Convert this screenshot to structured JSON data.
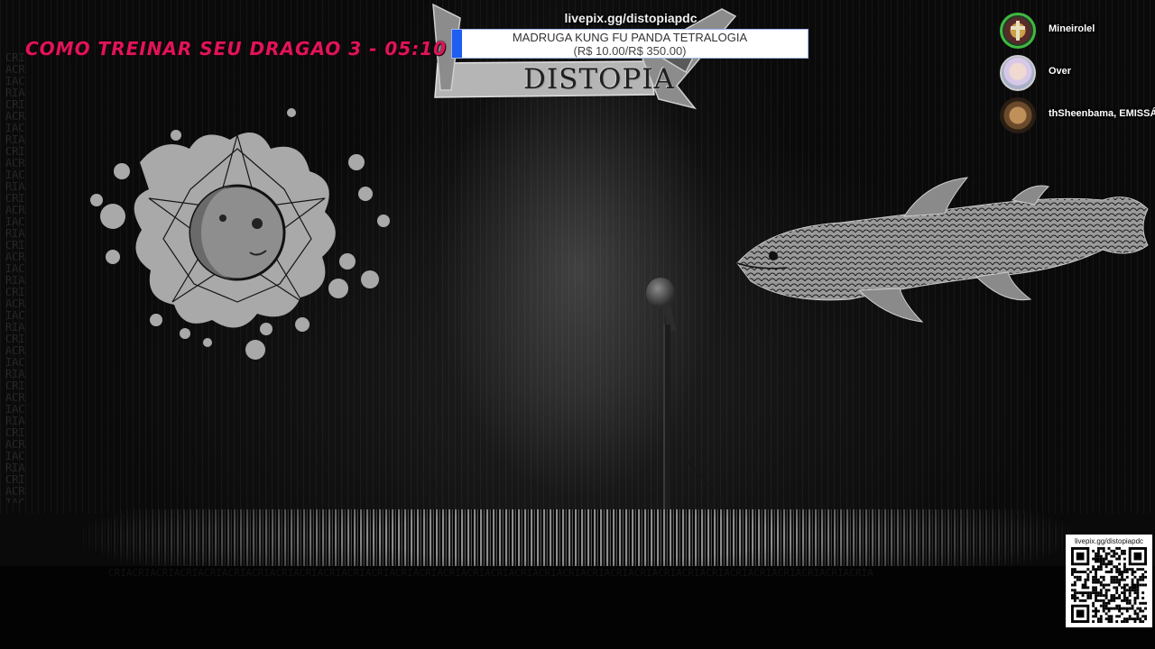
{
  "stream": {
    "title": "COMO TREINAR SEU DRAGAO 3 - 05:10",
    "logo_text": "DISTOPIA",
    "background_repeat_text": "CRIACRIACRIACRIACRIACRIACRIACRIACRIACRIACRIACRIACRIACRIACRIACRIACRIACRIACRIACRIACRIACRIACRIACRIACRIACRIACRIACRIACRIACRIACRIACRIA"
  },
  "donation_goal": {
    "url": "livepix.gg/distopiapdc",
    "name": "MADRUGA KUNG FU PANDA TETRALOGIA",
    "amount_text": "(R$ 10.00/R$ 350.00)",
    "current": 10,
    "target": 350,
    "bar_color": "#1e5ef0"
  },
  "voice_participants": [
    {
      "name": "Mineirolel",
      "ring_color": "#3fba3f"
    },
    {
      "name": "Over",
      "ring_color": "#cfcfcf"
    },
    {
      "name": "thSheenbama, EMISSÁR",
      "ring_color": "#8a6a40"
    }
  ],
  "qr": {
    "url": "livepix.gg/distopiapdc"
  },
  "icons": {
    "mic": "microphone-stand-icon",
    "sun_moon": "sun-moon-art",
    "fish": "coelacanth-art"
  }
}
